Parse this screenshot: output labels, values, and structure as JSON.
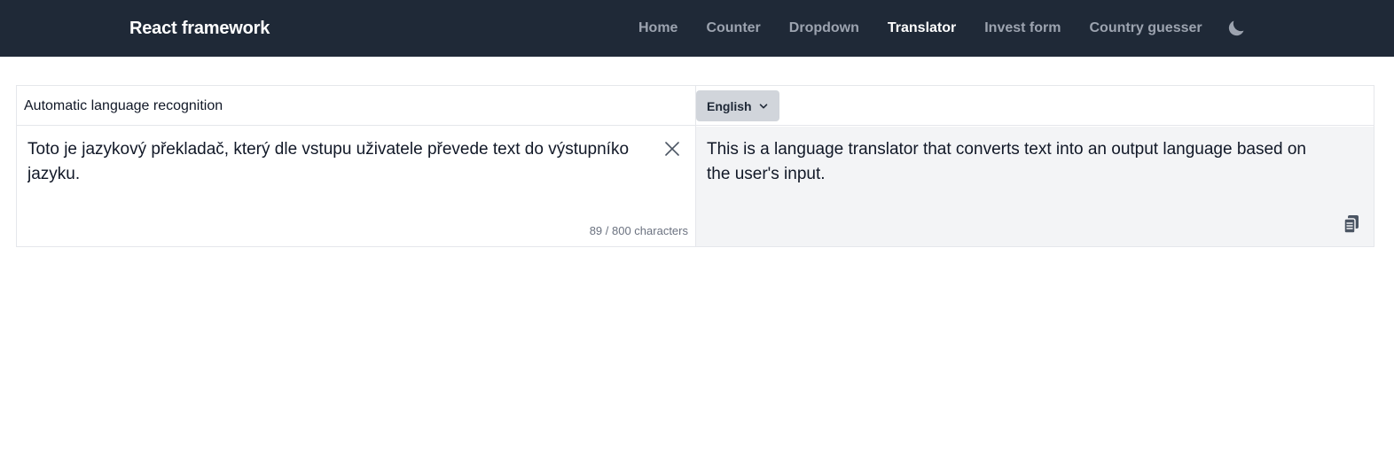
{
  "navbar": {
    "brand": "React framework",
    "links": [
      {
        "label": "Home",
        "active": false
      },
      {
        "label": "Counter",
        "active": false
      },
      {
        "label": "Dropdown",
        "active": false
      },
      {
        "label": "Translator",
        "active": true
      },
      {
        "label": "Invest form",
        "active": false
      },
      {
        "label": "Country guesser",
        "active": false
      }
    ],
    "theme_toggle_icon": "moon-icon"
  },
  "translator": {
    "source_language_label": "Automatic language recognition",
    "target_language": "English",
    "source_text": "Toto je jazykový překladač, který dle vstupu uživatele převede text do výstupníko jazyku.",
    "char_count": "89 / 800 characters",
    "translated_text": "This is a language translator that converts text into an output language based on the user's input.",
    "clear_icon": "close-icon",
    "copy_icon": "copy-icon"
  },
  "colors": {
    "navbar_bg": "#1f2937",
    "nav_link": "#9ca3af",
    "nav_link_active": "#ffffff",
    "target_pane_bg": "#f3f4f6",
    "select_bg": "#d1d5db",
    "border": "#e5e7eb"
  }
}
